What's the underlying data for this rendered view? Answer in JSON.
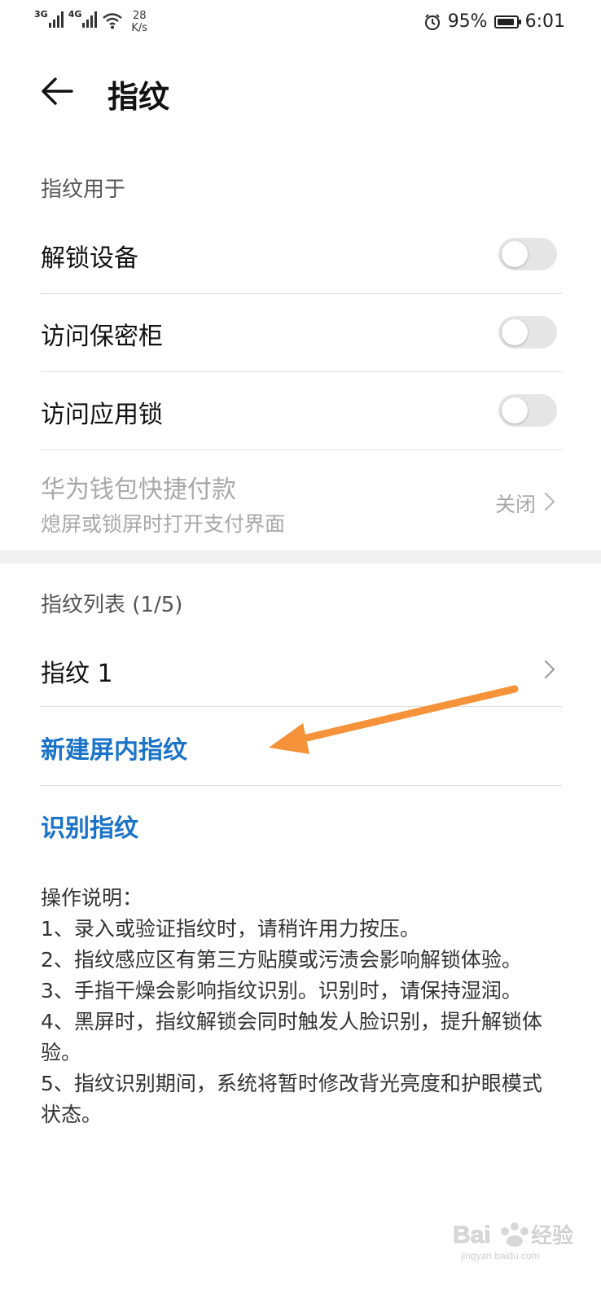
{
  "status_bar": {
    "net1": "3G",
    "net2": "4G",
    "speed_value": "28",
    "speed_unit": "K/s",
    "battery_percent": "95%",
    "battery_level": 0.95,
    "time": "6:01",
    "icons": [
      "signal-icon",
      "wifi-icon",
      "alarm-icon",
      "battery-icon"
    ]
  },
  "header": {
    "title": "指纹",
    "back_icon": "back-arrow-icon"
  },
  "usage_section": {
    "title": "指纹用于",
    "items": [
      {
        "label": "解锁设备",
        "enabled": false
      },
      {
        "label": "访问保密柜",
        "enabled": false
      },
      {
        "label": "访问应用锁",
        "enabled": false
      }
    ],
    "wallet": {
      "title": "华为钱包快捷付款",
      "subtitle": "熄屏或锁屏时打开支付界面",
      "value": "关闭"
    }
  },
  "list_section": {
    "title": "指纹列表 (1/5)",
    "items": [
      {
        "label": "指纹 1"
      }
    ],
    "new_fingerprint": "新建屏内指纹",
    "identify_fingerprint": "识别指纹"
  },
  "instructions": {
    "title": "操作说明：",
    "lines": [
      "1、录入或验证指纹时，请稍许用力按压。",
      "2、指纹感应区有第三方贴膜或污渍会影响解锁体验。",
      "3、手指干燥会影响指纹识别。识别时，请保持湿润。",
      "4、黑屏时，指纹解锁会同时触发人脸识别，提升解锁体验。",
      "5、指纹识别期间，系统将暂时修改背光亮度和护眼模式状态。"
    ]
  },
  "watermark": {
    "text": "Baidu经验",
    "subtext": "jingyan.baidu.com"
  },
  "colors": {
    "accent": "#1a73c8",
    "annotation": "#f5923a",
    "toggle_off": "#e5e5e5"
  }
}
